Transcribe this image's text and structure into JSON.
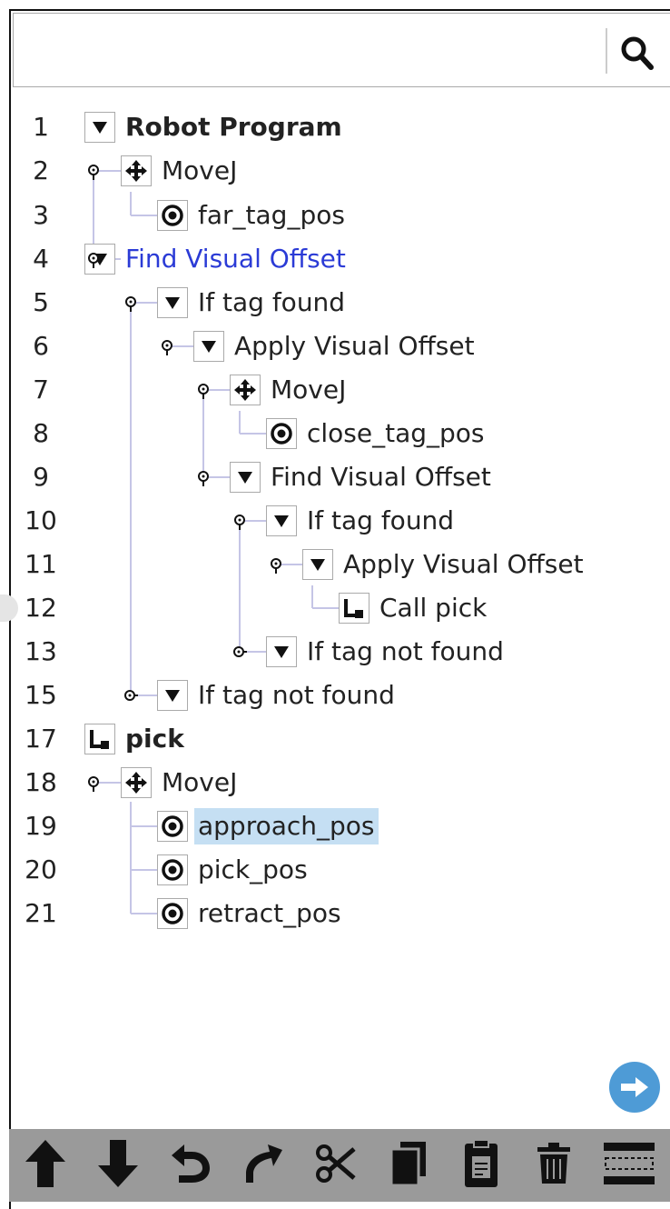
{
  "search": {
    "placeholder": "",
    "value": ""
  },
  "tree": [
    {
      "num": "1",
      "label": "Robot Program",
      "icon": "collapse-triangle-icon",
      "bold": true
    },
    {
      "num": "2",
      "label": "MoveJ",
      "icon": "move-arrows-icon"
    },
    {
      "num": "3",
      "label": "far_tag_pos",
      "icon": "waypoint-icon"
    },
    {
      "num": "4",
      "label": "Find Visual Offset",
      "icon": "collapse-triangle-icon",
      "highlight": "blue"
    },
    {
      "num": "5",
      "label": "If tag found",
      "icon": "collapse-triangle-icon"
    },
    {
      "num": "6",
      "label": "Apply Visual Offset",
      "icon": "collapse-triangle-icon"
    },
    {
      "num": "7",
      "label": "MoveJ",
      "icon": "move-arrows-icon"
    },
    {
      "num": "8",
      "label": "close_tag_pos",
      "icon": "waypoint-icon"
    },
    {
      "num": "9",
      "label": "Find Visual Offset",
      "icon": "collapse-triangle-icon"
    },
    {
      "num": "10",
      "label": "If tag found",
      "icon": "collapse-triangle-icon"
    },
    {
      "num": "11",
      "label": "Apply Visual Offset",
      "icon": "collapse-triangle-icon"
    },
    {
      "num": "12",
      "label": "Call pick",
      "icon": "subprogram-icon"
    },
    {
      "num": "13",
      "label": "If tag not found",
      "icon": "collapse-triangle-icon"
    },
    {
      "num": "15",
      "label": "If tag not found",
      "icon": "collapse-triangle-icon"
    },
    {
      "num": "17",
      "label": "pick",
      "icon": "subprogram-icon",
      "bold": true
    },
    {
      "num": "18",
      "label": "MoveJ",
      "icon": "move-arrows-icon"
    },
    {
      "num": "19",
      "label": "approach_pos",
      "icon": "waypoint-icon",
      "selected": true
    },
    {
      "num": "20",
      "label": "pick_pos",
      "icon": "waypoint-icon"
    },
    {
      "num": "21",
      "label": "retract_pos",
      "icon": "waypoint-icon"
    }
  ],
  "toolbar": [
    "move-up-icon",
    "move-down-icon",
    "undo-icon",
    "redo-icon",
    "cut-icon",
    "copy-icon",
    "paste-icon",
    "delete-icon",
    "suppress-icon"
  ],
  "colors": {
    "selection": "#c5dff3",
    "link_blue": "#2b3bd6",
    "toolbar_bg": "#9a9a9a",
    "next_button": "#4e9bd6"
  }
}
